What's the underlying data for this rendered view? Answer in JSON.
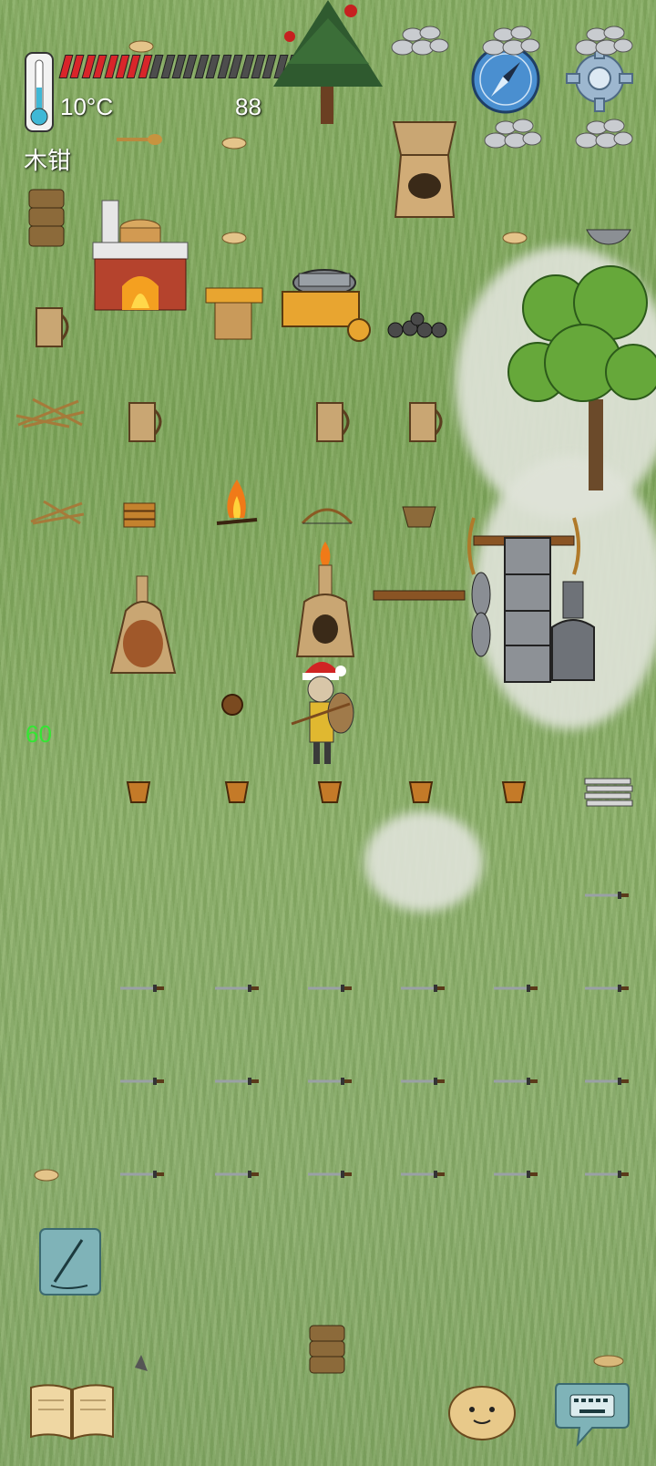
{
  "hud": {
    "temperature": "10°C",
    "food": "88",
    "held_item": "木钳",
    "age": "60",
    "hunger_pips_total": 22,
    "hunger_pips_filled": 8,
    "colors": {
      "hunger_full": "#d9252a",
      "hunger_empty": "#4d4d4d",
      "age_text": "#33e633"
    }
  },
  "buttons": {
    "compass": "compass-icon",
    "settings": "gear-icon",
    "note": "pencil-icon",
    "tech_book": "book-icon",
    "emote": "potato-face-icon",
    "chat": "keyboard-icon"
  }
}
